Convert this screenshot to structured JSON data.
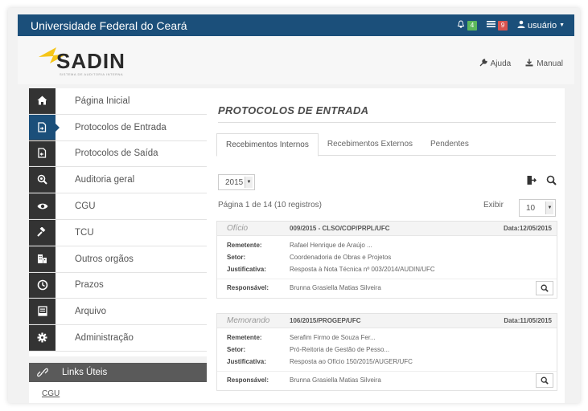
{
  "topbar": {
    "brand": "Universidade Federal do Ceará",
    "notifications_count": "4",
    "messages_count": "9",
    "user_label": "usuário"
  },
  "header": {
    "logo_text": "SADIN",
    "logo_subtitle": "SISTEMA DE AUDITORIA INTERNA",
    "help_label": "Ajuda",
    "manual_label": "Manual"
  },
  "sidebar": {
    "items": [
      {
        "label": "Página Inicial",
        "icon": "home-icon"
      },
      {
        "label": "Protocolos de Entrada",
        "icon": "document-in-icon"
      },
      {
        "label": "Protocolos de Saída",
        "icon": "document-out-icon"
      },
      {
        "label": "Auditoria geral",
        "icon": "audit-search-icon"
      },
      {
        "label": "CGU",
        "icon": "eye-icon"
      },
      {
        "label": "TCU",
        "icon": "gavel-icon"
      },
      {
        "label": "Outros orgãos",
        "icon": "building-icon"
      },
      {
        "label": "Prazos",
        "icon": "clock-icon"
      },
      {
        "label": "Arquivo",
        "icon": "archive-icon"
      },
      {
        "label": "Administração",
        "icon": "gear-icon"
      }
    ],
    "active_index": 1
  },
  "links_box": {
    "title": "Links Úteis",
    "links": [
      "CGU"
    ]
  },
  "main": {
    "title": "PROTOCOLOS DE ENTRADA",
    "tabs": [
      "Recebimentos Internos",
      "Recebimentos Externos",
      "Pendentes"
    ],
    "active_tab": 0,
    "year": "2015",
    "page_info": "Página 1 de 14 (10 registros)",
    "show_label": "Exibir",
    "per_page": "10"
  },
  "labels": {
    "remetente": "Remetente:",
    "setor": "Setor:",
    "justificativa": "Justificativa:",
    "responsavel": "Responsável:"
  },
  "records": [
    {
      "type": "Ofício",
      "number": "009/2015 - CLSO/COP/PRPL/UFC",
      "date": "Data:12/05/2015",
      "remetente": "Rafael Henrique de Araújo ...",
      "setor": "Coordenadoria de Obras e Projetos",
      "justificativa": "Resposta à Nota Técnica nº 003/2014/AUDIN/UFC",
      "responsavel": "Brunna Grasiella Matias Silveira"
    },
    {
      "type": "Memorando",
      "number": "106/2015/PROGEP/UFC",
      "date": "Data:11/05/2015",
      "remetente": "Serafim Firmo de Souza Fer...",
      "setor": "Pró-Reitoria de Gestão de Pesso...",
      "justificativa": "Resposta ao Ofício 150/2015/AUGER/UFC",
      "responsavel": "Brunna Grasiella Matias Silveira"
    }
  ],
  "colors": {
    "topbar": "#1b4f7a",
    "sidebar_icon_bg": "#333333",
    "badge_green": "#5cb85c",
    "badge_red": "#d9534f",
    "logo_sun": "#f5c518"
  }
}
